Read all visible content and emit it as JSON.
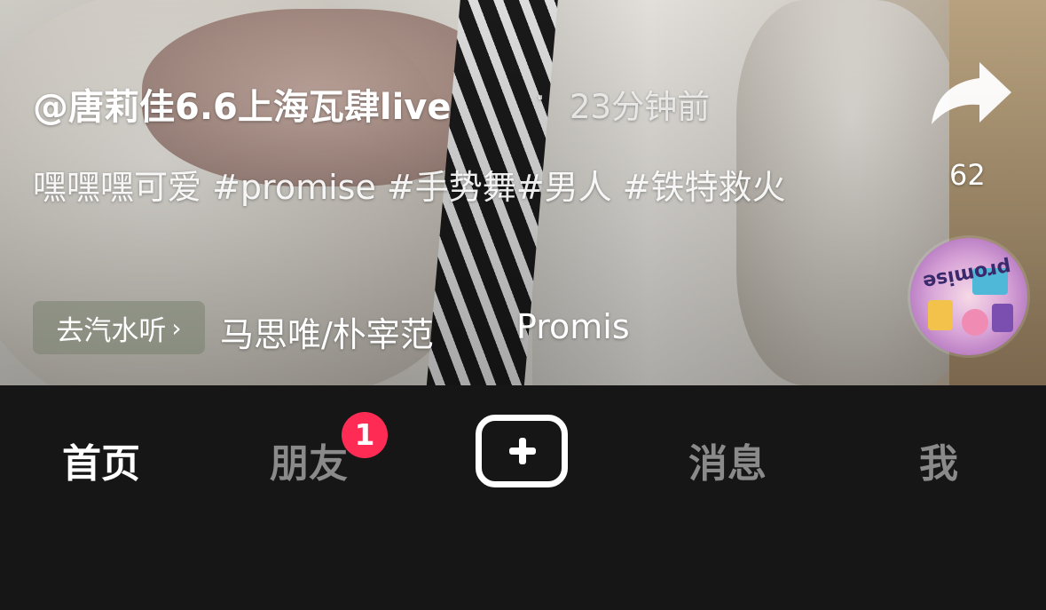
{
  "post": {
    "author": "@唐莉佳6.6上海瓦肆live",
    "separator": "·",
    "time": "23分钟前",
    "caption": "嘿嘿嘿可爱 #promise #手势舞#男人 #铁特救火"
  },
  "music": {
    "button_label": "去汽水听",
    "chevron": "›",
    "artist": "马思唯/朴宰范",
    "title_partial": "Promis"
  },
  "actions": {
    "share_count": "62",
    "disc_label": "promise"
  },
  "tabbar": {
    "home": "首页",
    "friends": "朋友",
    "friends_badge": "1",
    "messages": "消息",
    "me": "我"
  },
  "colors": {
    "badge": "#fe2c55",
    "tabbar_bg": "#161616",
    "tab_active": "#ffffff",
    "tab_inactive": "#8a8a8a"
  }
}
